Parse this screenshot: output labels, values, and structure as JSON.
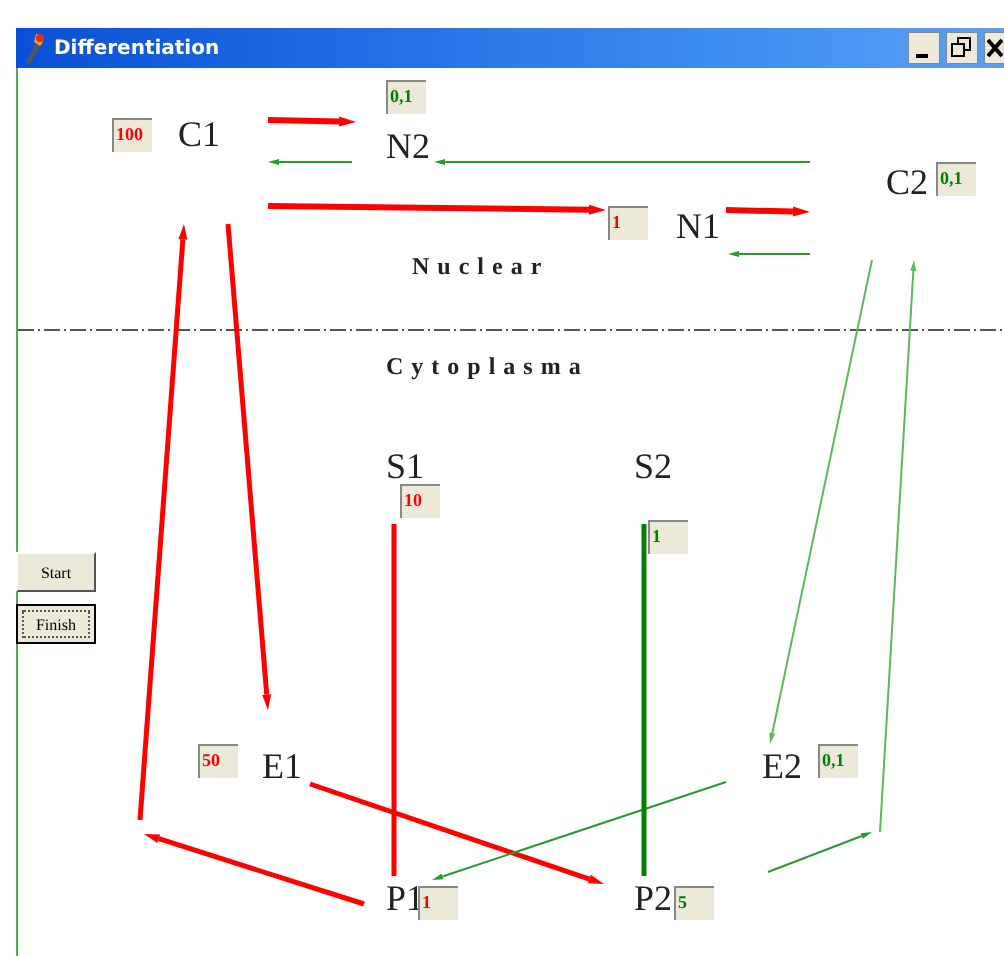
{
  "window": {
    "title": "Differentiation"
  },
  "regions": [
    {
      "label": "Nuclear"
    },
    {
      "label": "Cytoplasma"
    }
  ],
  "buttons": [
    {
      "label": "Start",
      "focused": false
    },
    {
      "label": "Finish",
      "focused": true
    }
  ],
  "nodes": [
    {
      "label": "C1",
      "value": "100",
      "color": "#ff0000"
    },
    {
      "label": "N2",
      "value": "0,1",
      "color": "#008000"
    },
    {
      "label": "N1",
      "value": "1",
      "color": "#ff0000"
    },
    {
      "label": "C2",
      "value": "0,1",
      "color": "#008000"
    },
    {
      "label": "S1",
      "value": "10",
      "color": "#ff0000"
    },
    {
      "label": "S2",
      "value": "1",
      "color": "#008000"
    },
    {
      "label": "E1",
      "value": "50",
      "color": "#ff0000"
    },
    {
      "label": "E2",
      "value": "0,1",
      "color": "#008000"
    },
    {
      "label": "P1",
      "value": "1",
      "color": "#ff0000"
    },
    {
      "label": "P2",
      "value": "5",
      "color": "#008000"
    }
  ]
}
